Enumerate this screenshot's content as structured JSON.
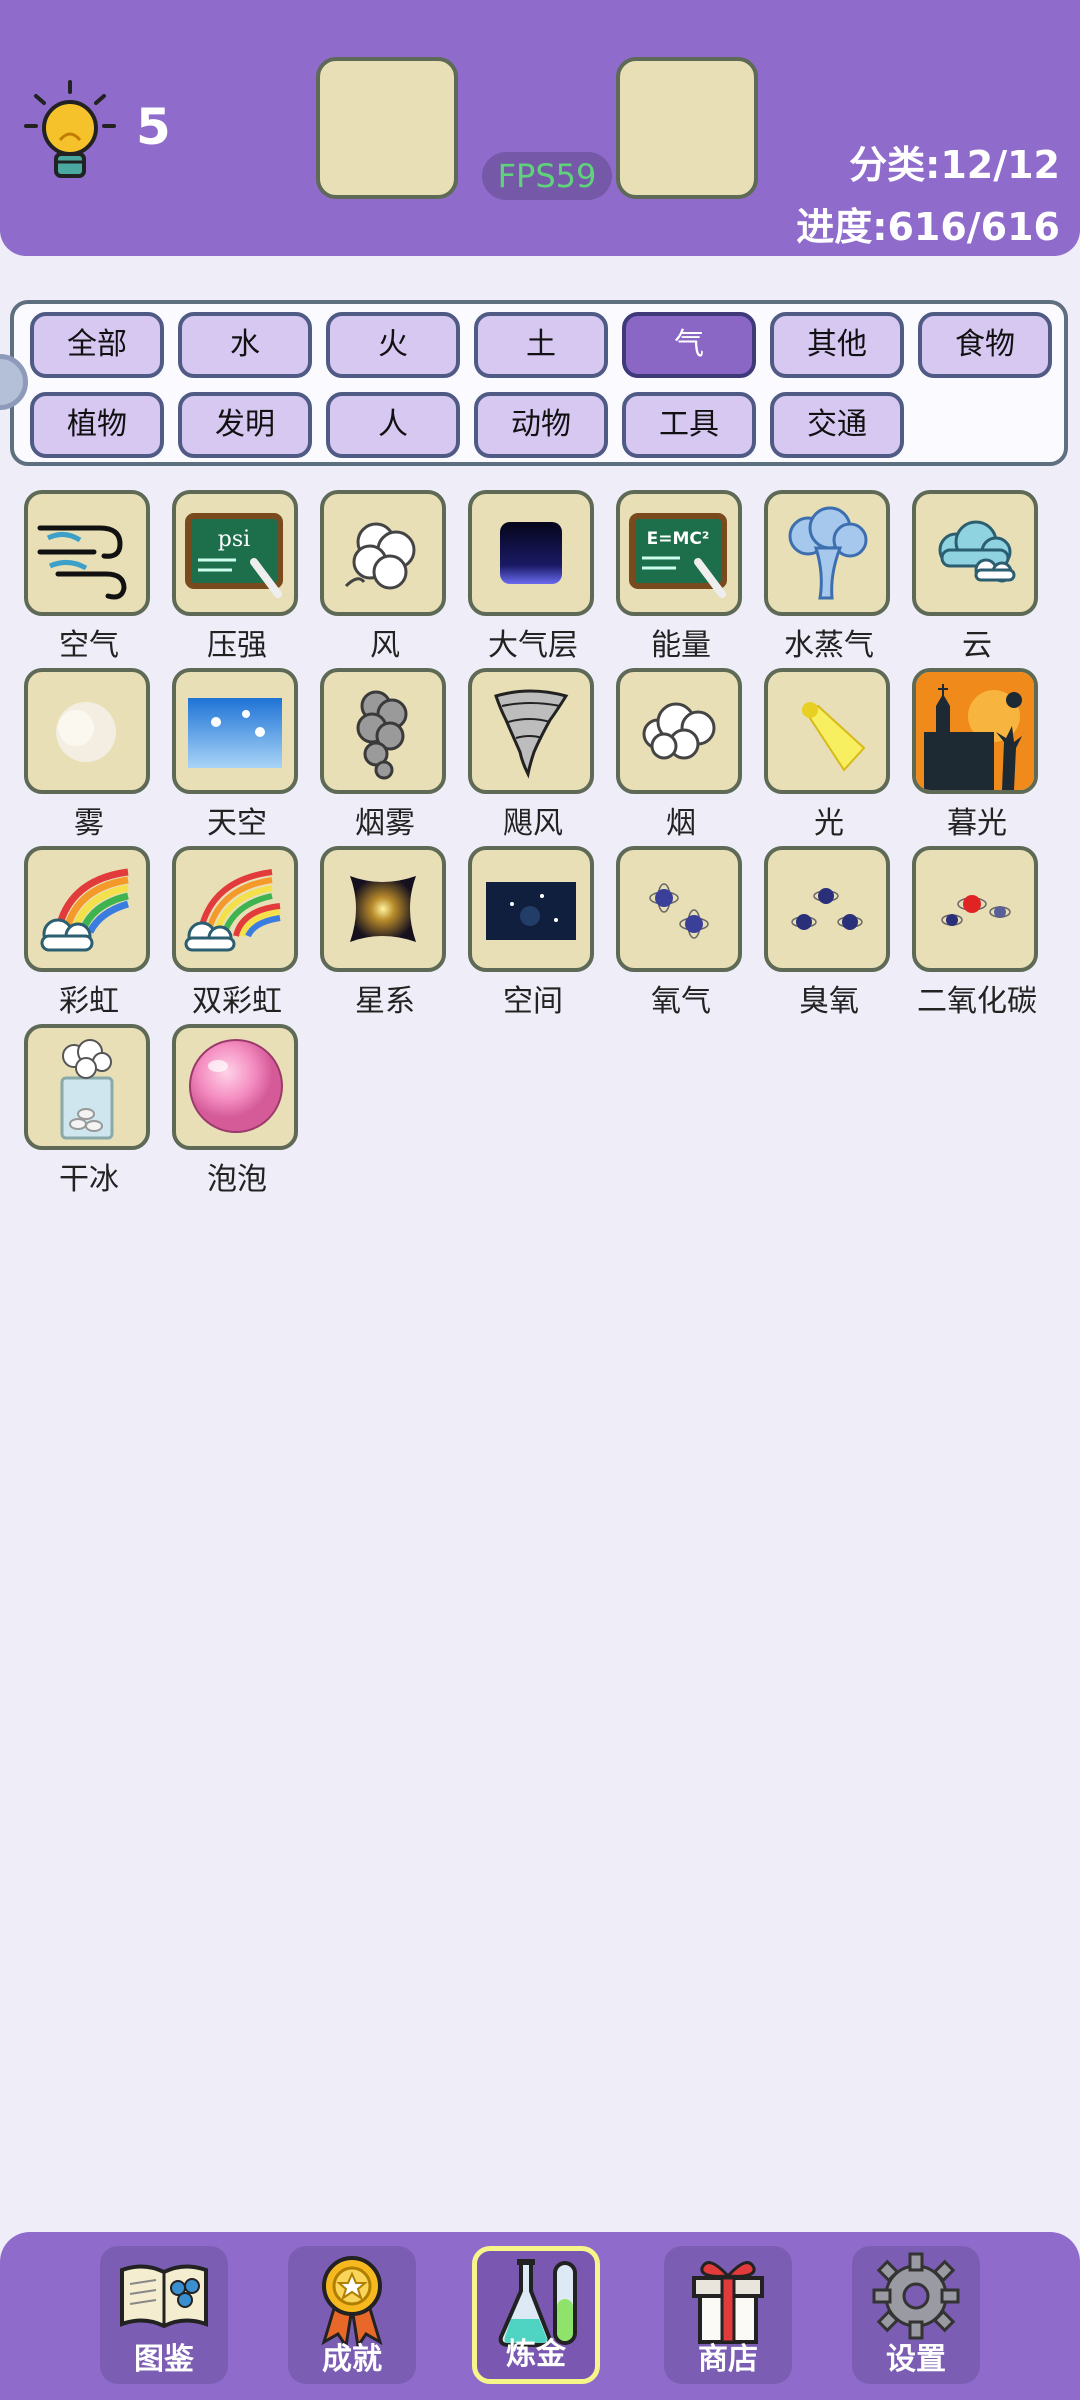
{
  "header": {
    "hint_count": "5",
    "fps": "FPS59",
    "category_stat": "分类:12/12",
    "progress_stat": "进度:616/616"
  },
  "filters": [
    "全部",
    "水",
    "火",
    "土",
    "气",
    "其他",
    "食物",
    "植物",
    "发明",
    "人",
    "动物",
    "工具",
    "交通"
  ],
  "active_filter": "气",
  "items": [
    "空气",
    "压强",
    "风",
    "大气层",
    "能量",
    "水蒸气",
    "云",
    "雾",
    "天空",
    "烟雾",
    "飓风",
    "烟",
    "光",
    "暮光",
    "彩虹",
    "双彩虹",
    "星系",
    "空间",
    "氧气",
    "臭氧",
    "二氧化碳",
    "干冰",
    "泡泡"
  ],
  "icons": {
    "压强": "psi",
    "能量": "E=MC²"
  },
  "nav": [
    {
      "label": "图鉴",
      "icon": "book-icon"
    },
    {
      "label": "成就",
      "icon": "medal-icon"
    },
    {
      "label": "炼金",
      "icon": "flask-icon",
      "active": true
    },
    {
      "label": "商店",
      "icon": "gift-icon"
    },
    {
      "label": "设置",
      "icon": "gear-icon"
    }
  ],
  "colors": {
    "accent": "#8f6ccc",
    "tile": "#e8dfb6",
    "tile_border": "#5e6a56",
    "active_filter": "#8a66c5",
    "fps_text": "#5ed37a"
  }
}
